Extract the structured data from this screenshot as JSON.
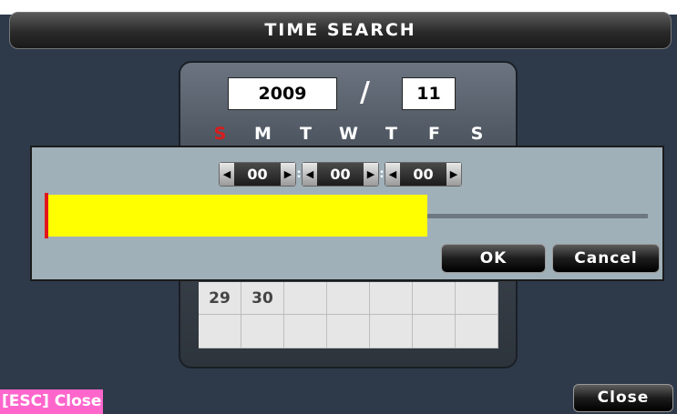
{
  "title": "TIME SEARCH",
  "calendar": {
    "year": "2009",
    "separator": "/",
    "month": "11",
    "weekdays": [
      "S",
      "M",
      "T",
      "W",
      "T",
      "F",
      "S"
    ],
    "last_week_days": [
      "29",
      "30",
      "",
      "",
      "",
      "",
      ""
    ]
  },
  "time_dialog": {
    "hour": "00",
    "minute": "00",
    "second": "00",
    "time_separator": ":",
    "progress_fraction": 0.63,
    "ok_label": "OK",
    "cancel_label": "Cancel"
  },
  "footer": {
    "esc_hint": "[ESC] Close",
    "close_label": "Close"
  },
  "colors": {
    "progress_fill": "#ffff00",
    "marker": "#e01818",
    "sunday": "#d81c1c",
    "esc_hint_bg": "#ff66cc"
  }
}
